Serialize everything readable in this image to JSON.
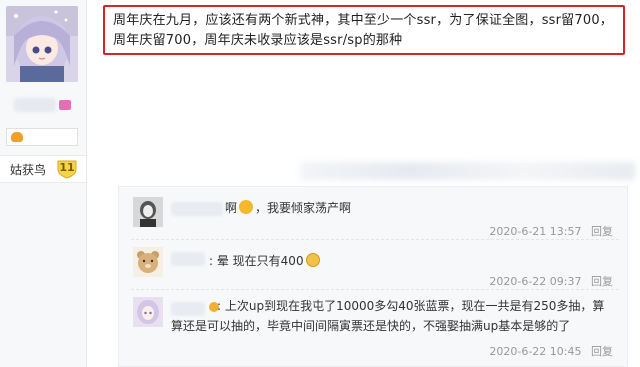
{
  "user": {
    "level_title": "姑获鸟",
    "level_number": "11"
  },
  "post": {
    "text": "周年庆在九月，应该还有两个新式神，其中至少一个ssr，为了保证全图，ssr留700，周年庆留700，周年庆未收录应该是ssr/sp的那种",
    "highlight_color": "#d9232b"
  },
  "comments": [
    {
      "avatar_icon": "monochrome-girl-avatar",
      "user_suffix": "啊",
      "text": "，我要倾家荡产啊",
      "datetime": "2020-6-21 13:57",
      "reply_label": "回复"
    },
    {
      "avatar_icon": "bear-avatar",
      "user_suffix": "",
      "text": ": 晕 现在只有400",
      "datetime": "2020-6-22 09:37",
      "reply_label": "回复"
    },
    {
      "avatar_icon": "anime-girl-avatar",
      "user_suffix": "",
      "text_line1": ": 上次up到现在我屯了10000多勾40张蓝票，现在一共是有250多抽，算",
      "text_line2": "算还是可以抽的，毕竟中间间隔寅票还是快的，不强娶抽满up基本是够的了",
      "datetime": "2020-6-22 10:45",
      "reply_label": "回复"
    }
  ]
}
